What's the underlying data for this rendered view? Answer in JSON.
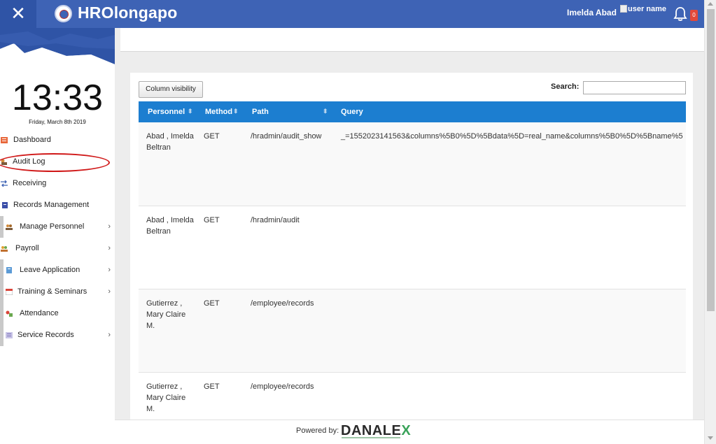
{
  "header": {
    "app_title": "HROlongapo",
    "user_name": "Imelda Abad",
    "user_image_alt": "user name",
    "notification_count": "0"
  },
  "sidebar": {
    "clock_time": "13:33",
    "date": "Friday, March 8th 2019",
    "items": [
      {
        "label": "Dashboard",
        "icon": "dashboard-icon"
      },
      {
        "label": "Audit Log",
        "icon": "audit-log-icon"
      },
      {
        "label": "Receiving",
        "icon": "transfer-arrows-icon"
      },
      {
        "label": "Records Management",
        "icon": "records-icon"
      },
      {
        "label": "Manage Personnel",
        "icon": "personnel-icon",
        "chevron": "›"
      },
      {
        "label": "Payroll",
        "icon": "payroll-icon",
        "chevron": "›"
      },
      {
        "label": "Leave Application",
        "icon": "leave-icon",
        "chevron": "›"
      },
      {
        "label": "Training & Seminars",
        "icon": "calendar-icon",
        "chevron": "›"
      },
      {
        "label": "Attendance",
        "icon": "attendance-icon"
      },
      {
        "label": "Service Records",
        "icon": "service-records-icon",
        "chevron": "›"
      }
    ]
  },
  "toolbar": {
    "column_visibility_label": "Column visibility",
    "search_label": "Search:",
    "search_value": ""
  },
  "table": {
    "columns": [
      "Personnel",
      "Method",
      "Path",
      "Query"
    ],
    "sort_icon": "⬍",
    "rows": [
      {
        "personnel": "Abad , Imelda Beltran",
        "method": "GET",
        "path": "/hradmin/audit_show",
        "query": "_=1552023141563&columns%5B0%5D%5Bdata%5D=real_name&columns%5B0%5D%5Bname%5"
      },
      {
        "personnel": "Abad , Imelda Beltran",
        "method": "GET",
        "path": "/hradmin/audit",
        "query": ""
      },
      {
        "personnel": "Gutierrez , Mary Claire M.",
        "method": "GET",
        "path": "/employee/records",
        "query": ""
      },
      {
        "personnel": "Gutierrez , Mary Claire M.",
        "method": "GET",
        "path": "/employee/records",
        "query": ""
      }
    ]
  },
  "footer": {
    "powered_by": "Powered by:",
    "brand_main": "DANALE",
    "brand_x": "X"
  },
  "colors": {
    "topbar": "#3e63b5",
    "table_header": "#1c7ed0",
    "highlight_oval": "#d01818"
  }
}
